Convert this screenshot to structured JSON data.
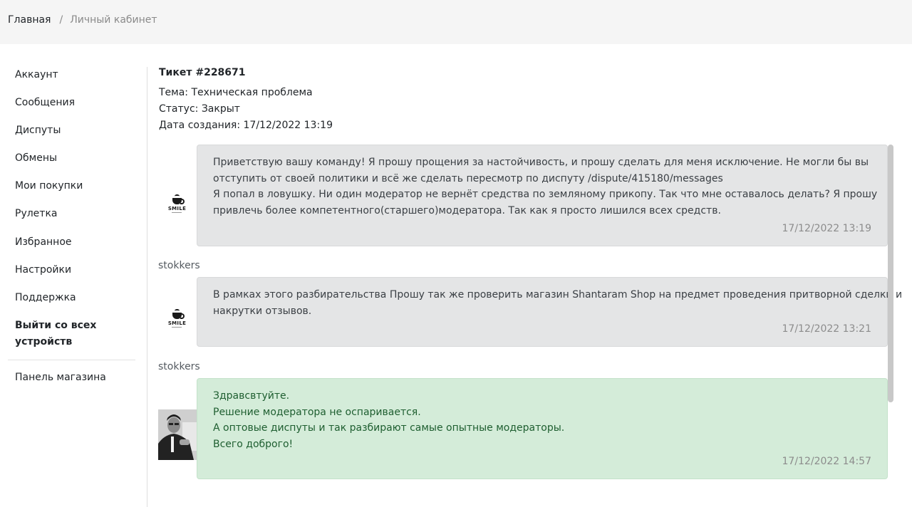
{
  "breadcrumb": {
    "home": "Главная",
    "separator": "/",
    "current": "Личный кабинет"
  },
  "sidebar": {
    "items": [
      {
        "label": "Аккаунт"
      },
      {
        "label": "Сообщения"
      },
      {
        "label": "Диспуты"
      },
      {
        "label": "Обмены"
      },
      {
        "label": "Мои покупки"
      },
      {
        "label": "Рулетка"
      },
      {
        "label": "Избранное"
      },
      {
        "label": "Настройки"
      },
      {
        "label": "Поддержка"
      }
    ],
    "logout_all_line1": "Выйти со всех",
    "logout_all_line2": "устройств",
    "shop_panel": "Панель магазина"
  },
  "ticket": {
    "title": "Тикет #228671",
    "topic": "Тема: Техническая проблема",
    "status": "Статус: Закрыт",
    "created": "Дата создания: 17/12/2022 13:19"
  },
  "messages": [
    {
      "author": "",
      "avatar": "smile-logo",
      "avatar_text": "SMILE",
      "lines": [
        "Приветствую вашу команду! Я прошу прощения за настойчивость, и прошу сделать для меня исключение. Не могли бы вы",
        "отступить от своей политики и всё же сделать пересмотр по диспуту /dispute/415180/messages",
        "Я попал в ловушку. Ни один модератор не вернёт средства по земляному прикопу. Так что мне оставалось делать? Я прошу",
        "привлечь более компетентного(старшего)модератора. Так как я просто лишился всех средств."
      ],
      "time": "17/12/2022 13:19"
    },
    {
      "author": "stokkers",
      "avatar": "smile-logo",
      "avatar_text": "SMILE",
      "lines": [
        "В рамках этого разбирательства Прошу так же проверить магазин Shantaram Shop на предмет проведения притворной сделки и",
        "накрутки отзывов."
      ],
      "time": "17/12/2022 13:21"
    },
    {
      "author": "stokkers",
      "avatar": "moderator-photo",
      "lines": [
        "Здравсвтуйте.",
        "Решение модератора не оспаривается.",
        "А оптовые диспуты и так разбирают самые опытные модераторы.",
        "Всего доброго!"
      ],
      "time": "17/12/2022 14:57"
    }
  ],
  "colors": {
    "topbar_bg": "#f5f5f5",
    "bubble_grey": "#e4e5e6",
    "bubble_green": "#d4ecd9",
    "green_text": "#1e5e30",
    "muted_text": "#8c8c8c"
  }
}
